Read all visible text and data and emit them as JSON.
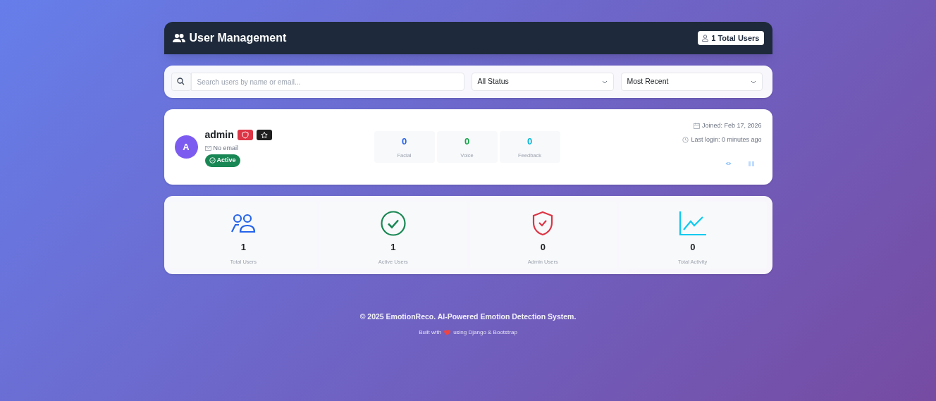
{
  "header": {
    "title": "User Management",
    "badge": "1 Total Users"
  },
  "filters": {
    "search": {
      "placeholder": "Search users by name or email..."
    },
    "selects": [
      {
        "value": "All Status"
      },
      {
        "value": "Most Recent"
      }
    ]
  },
  "users": [
    {
      "initial": "A",
      "name": "admin",
      "is_admin": true,
      "is_staff": true,
      "email": "No email",
      "status": "Active",
      "active": true,
      "stats": [
        {
          "value": "0",
          "label": "Facial",
          "color": "#2563eb"
        },
        {
          "value": "0",
          "label": "Voice",
          "color": "#16a34a"
        },
        {
          "value": "0",
          "label": "Feedback",
          "color": "#06b6d4"
        }
      ],
      "joined": "Joined: Feb 17, 2026",
      "last_login": "Last login: 0 minutes ago"
    }
  ],
  "summary": [
    {
      "kind": "users",
      "value": "1",
      "label": "Total Users",
      "color": "#2563eb"
    },
    {
      "kind": "check",
      "value": "1",
      "label": "Active Users",
      "color": "#198754"
    },
    {
      "kind": "shield",
      "value": "0",
      "label": "Admin Users",
      "color": "#dc3545"
    },
    {
      "kind": "chart",
      "value": "0",
      "label": "Total Activity",
      "color": "#0dcaf0"
    }
  ],
  "footer": {
    "copyright": "© 2025 EmotionReco. AI-Powered Emotion Detection System.",
    "built_before": "Built with",
    "built_after": "using Django & Bootstrap"
  }
}
